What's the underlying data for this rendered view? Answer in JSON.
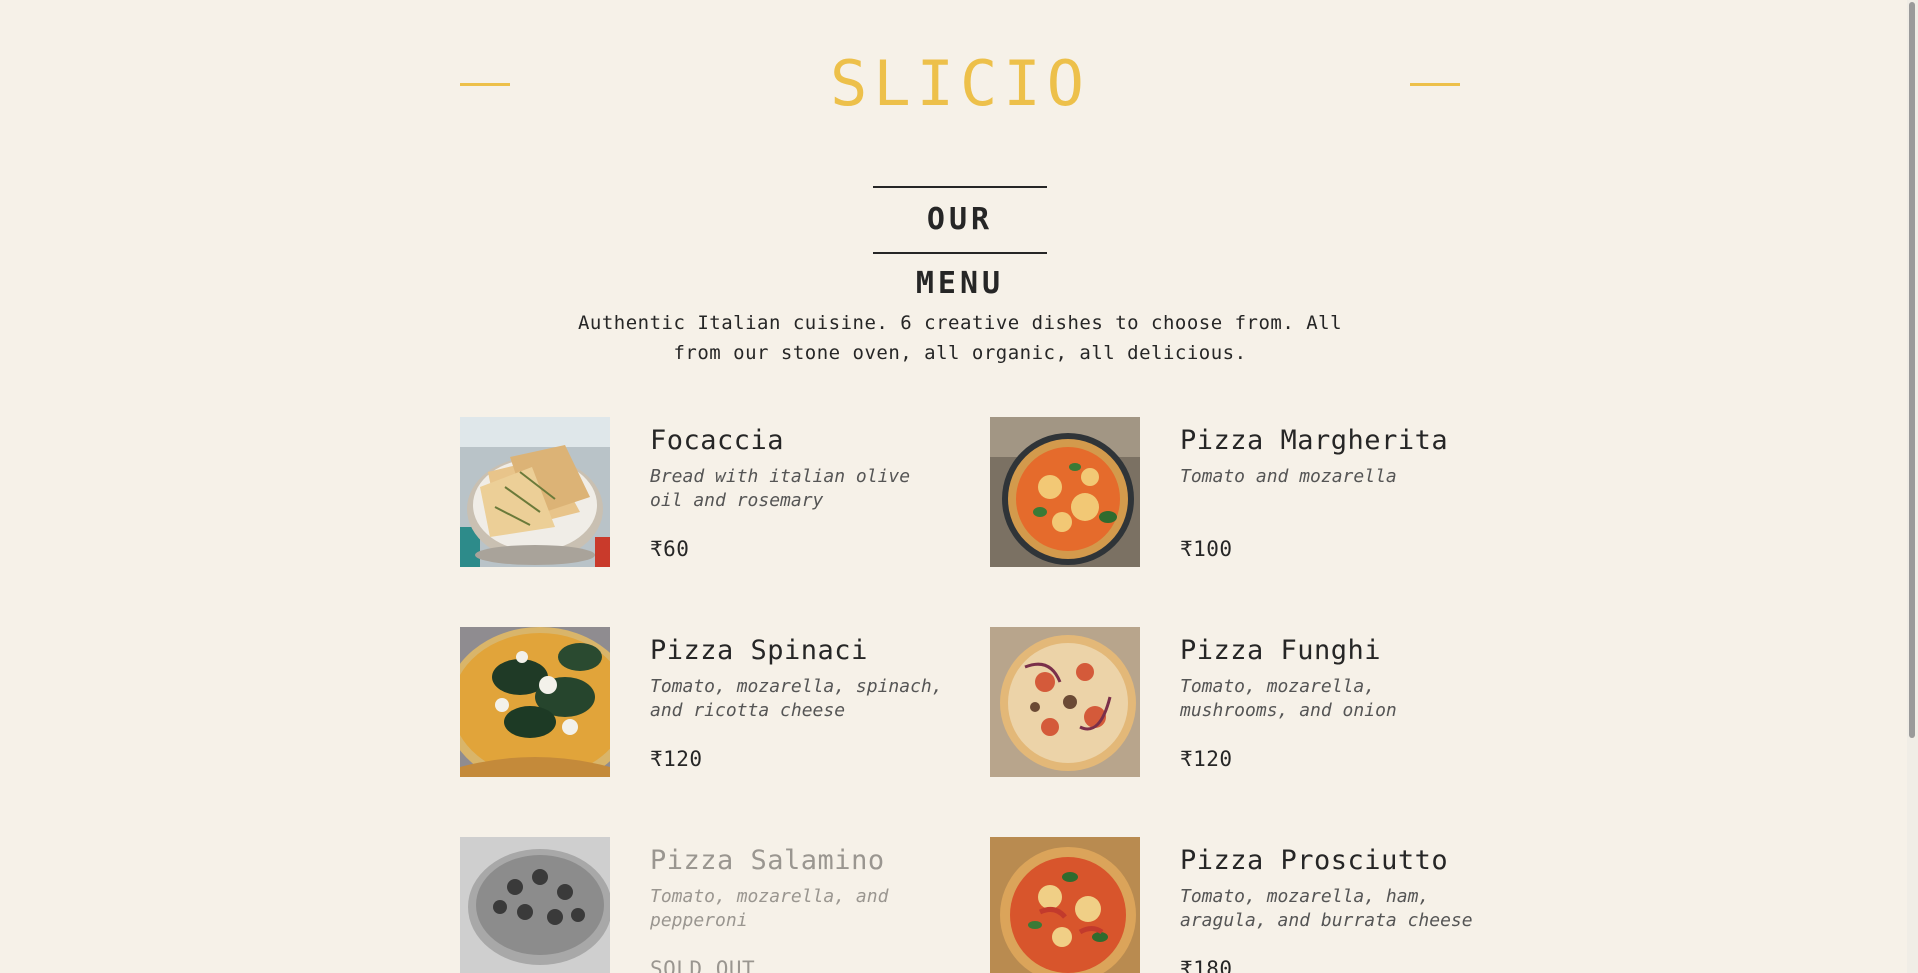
{
  "header": {
    "logo": "SLICIO"
  },
  "menu": {
    "title": "OUR MENU",
    "intro": "Authentic Italian cuisine. 6 creative dishes to choose from. All from our stone oven, all organic, all delicious.",
    "items": [
      {
        "name": "Focaccia",
        "ingredients": "Bread with italian olive oil and rosemary",
        "price": "₹60",
        "sold_out": false,
        "photo": "focaccia-photo"
      },
      {
        "name": "Pizza Margherita",
        "ingredients": "Tomato and mozarella",
        "price": "₹100",
        "sold_out": false,
        "photo": "pizza-margherita-photo"
      },
      {
        "name": "Pizza Spinaci",
        "ingredients": "Tomato, mozarella, spinach, and ricotta cheese",
        "price": "₹120",
        "sold_out": false,
        "photo": "pizza-spinaci-photo"
      },
      {
        "name": "Pizza Funghi",
        "ingredients": "Tomato, mozarella, mushrooms, and onion",
        "price": "₹120",
        "sold_out": false,
        "photo": "pizza-funghi-photo"
      },
      {
        "name": "Pizza Salamino",
        "ingredients": "Tomato, mozarella, and pepperoni",
        "price": "SOLD OUT",
        "sold_out": true,
        "photo": "pizza-salamino-photo"
      },
      {
        "name": "Pizza Prosciutto",
        "ingredients": "Tomato, mozarella, ham, aragula, and burrata cheese",
        "price": "₹180",
        "sold_out": false,
        "photo": "pizza-prosciutto-photo"
      }
    ]
  },
  "colors": {
    "background": "#f6f1e8",
    "accent": "#edc04a",
    "text": "#262626",
    "muted": "#9a9690"
  }
}
